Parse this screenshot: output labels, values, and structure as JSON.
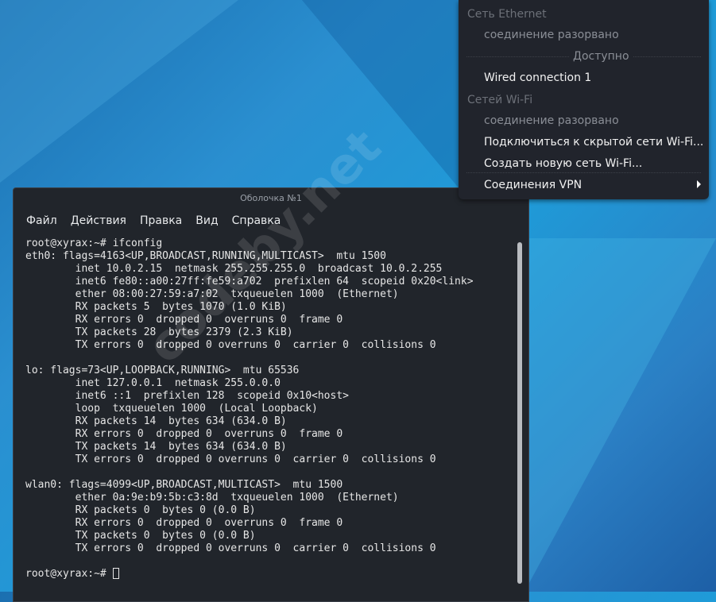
{
  "terminal": {
    "title": "Оболочка №1",
    "menu": [
      "Файл",
      "Действия",
      "Правка",
      "Вид",
      "Справка"
    ],
    "lines": [
      "root@xyrax:~# ifconfig",
      "eth0: flags=4163<UP,BROADCAST,RUNNING,MULTICAST>  mtu 1500",
      "        inet 10.0.2.15  netmask 255.255.255.0  broadcast 10.0.2.255",
      "        inet6 fe80::a00:27ff:fe59:a702  prefixlen 64  scopeid 0x20<link>",
      "        ether 08:00:27:59:a7:02  txqueuelen 1000  (Ethernet)",
      "        RX packets 5  bytes 1070 (1.0 KiB)",
      "        RX errors 0  dropped 0  overruns 0  frame 0",
      "        TX packets 28  bytes 2379 (2.3 KiB)",
      "        TX errors 0  dropped 0 overruns 0  carrier 0  collisions 0",
      "",
      "lo: flags=73<UP,LOOPBACK,RUNNING>  mtu 65536",
      "        inet 127.0.0.1  netmask 255.0.0.0",
      "        inet6 ::1  prefixlen 128  scopeid 0x10<host>",
      "        loop  txqueuelen 1000  (Local Loopback)",
      "        RX packets 14  bytes 634 (634.0 B)",
      "        RX errors 0  dropped 0  overruns 0  frame 0",
      "        TX packets 14  bytes 634 (634.0 B)",
      "        TX errors 0  dropped 0 overruns 0  carrier 0  collisions 0",
      "",
      "wlan0: flags=4099<UP,BROADCAST,MULTICAST>  mtu 1500",
      "        ether 0a:9e:b9:5b:c3:8d  txqueuelen 1000  (Ethernet)",
      "        RX packets 0  bytes 0 (0.0 B)",
      "        RX errors 0  dropped 0  overruns 0  frame 0",
      "        TX packets 0  bytes 0 (0.0 B)",
      "        TX errors 0  dropped 0 overruns 0  carrier 0  collisions 0",
      ""
    ],
    "prompt": "root@xyrax:~# "
  },
  "watermark": "codeby.net",
  "network_menu": {
    "ethernet_header": "Сеть Ethernet",
    "ethernet_status": "соединение разорвано",
    "available_label": "Доступно",
    "wired_connection": "Wired connection 1",
    "wifi_header": "Сетей Wi-Fi",
    "wifi_status": "соединение разорвано",
    "connect_hidden": "Подключиться к скрытой сети Wi-Fi...",
    "create_new": "Создать новую сеть Wi-Fi...",
    "vpn": "Соединения VPN"
  }
}
